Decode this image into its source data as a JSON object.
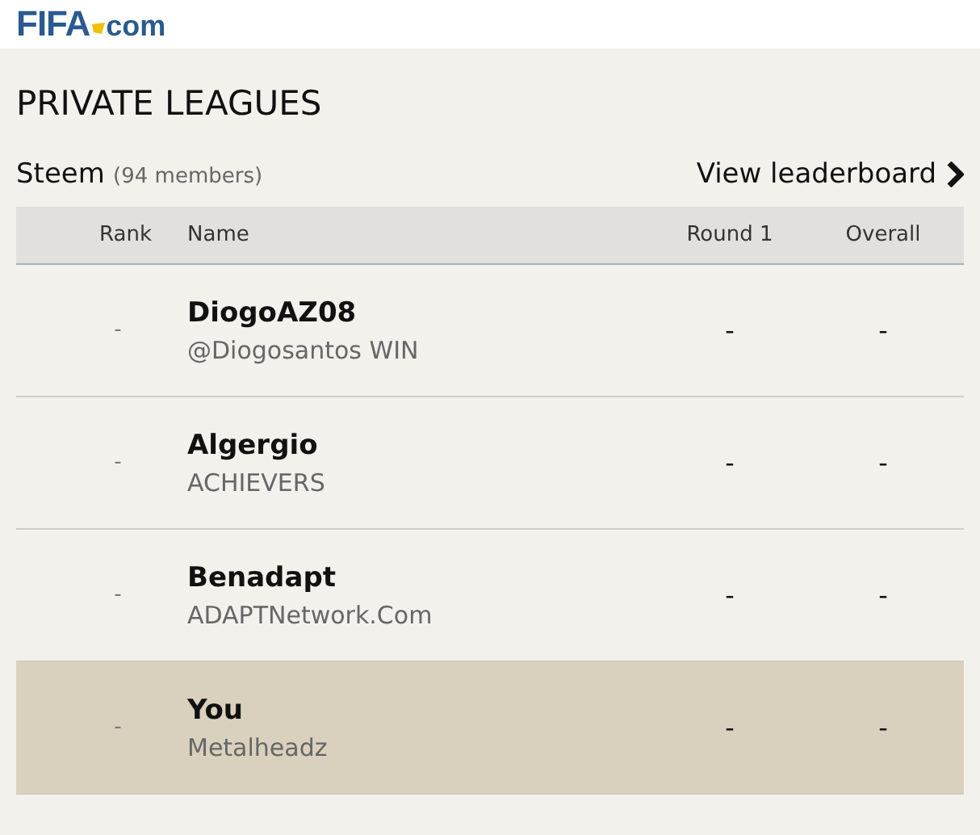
{
  "logo": {
    "brand": "FIFA",
    "suffix": "com"
  },
  "page_title": "PRIVATE LEAGUES",
  "league": {
    "name": "Steem",
    "members": "(94 members)",
    "link": "View leaderboard"
  },
  "table": {
    "columns": [
      "Rank",
      "Name",
      "Round 1",
      "Overall"
    ],
    "rows": [
      {
        "rank": "-",
        "name": "DiogoAZ08",
        "team": "@Diogosantos WIN",
        "round_1": "-",
        "overall": "-",
        "highlighted": false
      },
      {
        "rank": "-",
        "name": "Algergio",
        "team": "ACHIEVERS",
        "round_1": "-",
        "overall": "-",
        "highlighted": false
      },
      {
        "rank": "-",
        "name": "Benadapt",
        "team": "ADAPTNetwork.Com",
        "round_1": "-",
        "overall": "-",
        "highlighted": false
      },
      {
        "rank": "-",
        "name": "You",
        "team": "Metalheadz",
        "round_1": "-",
        "overall": "-",
        "highlighted": true
      }
    ]
  }
}
